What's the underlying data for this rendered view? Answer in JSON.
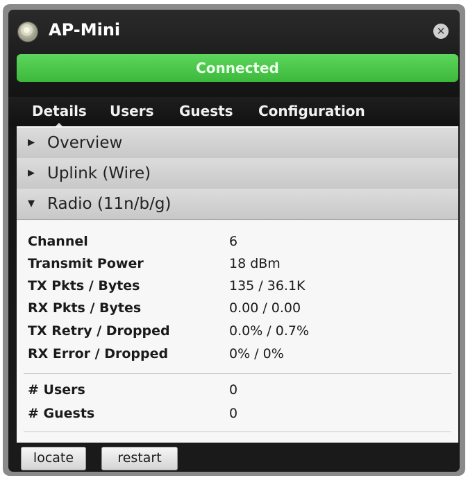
{
  "window": {
    "title": "AP-Mini",
    "status": "Connected",
    "status_color": "#44c044"
  },
  "tabs": [
    {
      "label": "Details",
      "active": true
    },
    {
      "label": "Users",
      "active": false
    },
    {
      "label": "Guests",
      "active": false
    },
    {
      "label": "Configuration",
      "active": false
    }
  ],
  "sections": [
    {
      "label": "Overview",
      "expanded": false
    },
    {
      "label": "Uplink (Wire)",
      "expanded": false
    },
    {
      "label": "Radio (11n/b/g)",
      "expanded": true
    }
  ],
  "radio": {
    "rows": [
      {
        "key": "Channel",
        "value": "6"
      },
      {
        "key": "Transmit Power",
        "value": "18 dBm"
      },
      {
        "key": "TX Pkts / Bytes",
        "value": "135 / 36.1K"
      },
      {
        "key": "RX Pkts / Bytes",
        "value": "0.00 / 0.00"
      },
      {
        "key": "TX Retry / Dropped",
        "value": "0.0% / 0.7%"
      },
      {
        "key": "RX Error / Dropped",
        "value": "0% / 0%"
      }
    ],
    "counts": [
      {
        "key": "# Users",
        "value": "0"
      },
      {
        "key": "# Guests",
        "value": "0"
      }
    ]
  },
  "icons": {
    "collapsed": "▶",
    "expanded": "▼",
    "close": "✕"
  },
  "buttons": {
    "locate": "locate",
    "restart": "restart"
  }
}
